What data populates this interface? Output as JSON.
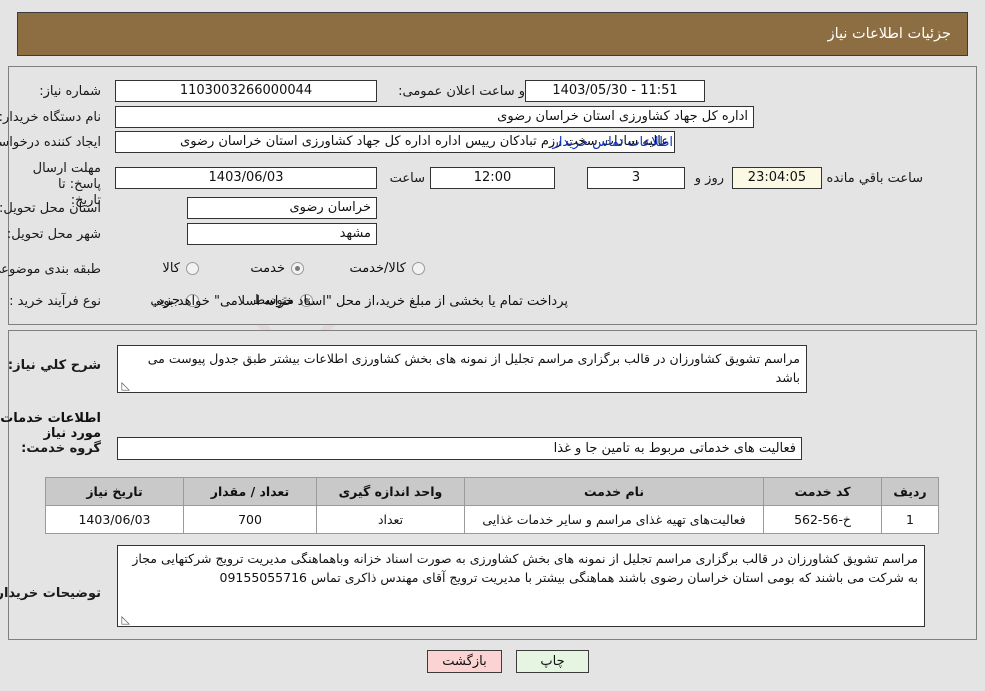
{
  "header": {
    "title": "جزئیات اطلاعات نیاز"
  },
  "watermark": {
    "text": "AriaTender.net",
    "shield_color": "#e8c0c4"
  },
  "form": {
    "need_number_label": "شماره نیاز:",
    "need_number_value": "1103003266000044",
    "public_announce_label": "تاریخ و ساعت اعلان عمومی:",
    "public_announce_value": "11:51 - 1403/05/30",
    "buyer_org_label": "نام دستگاه خریدار:",
    "buyer_org_value": "اداره کل جهاد کشاورزی استان خراسان رضوی",
    "requester_label": "ایجاد کننده درخواست:",
    "requester_value": "عالیه سادات سخت رزم تبادکان رییس اداره  اداره کل جهاد کشاورزی استان خراسان رضوی",
    "buyer_contact_link": "اطلاعات تماس خریدار",
    "deadline_label": "مهلت ارسال پاسخ: تا تاریخ:",
    "deadline_date": "1403/06/03",
    "hour_label": "ساعت",
    "deadline_time": "12:00",
    "days_remaining": "3",
    "days_label": "روز و",
    "countdown": "23:04:05",
    "remaining_label": "ساعت باقي مانده",
    "province_label": "استان محل تحویل:",
    "province_value": "خراسان رضوی",
    "city_label": "شهر محل تحویل:",
    "city_value": "مشهد",
    "category_label": "طبقه بندی موضوعی:",
    "category_options": [
      {
        "label": "کالا",
        "selected": false
      },
      {
        "label": "خدمت",
        "selected": true
      },
      {
        "label": "کالا/خدمت",
        "selected": false
      }
    ],
    "process_label": "نوع فرآیند خرید :",
    "process_options": [
      {
        "label": "جزیي",
        "selected": false
      },
      {
        "label": "متوسط",
        "selected": true
      }
    ],
    "treasury_note": "پرداخت تمام یا بخشی از مبلغ خرید،از محل \"اسناد خزانه اسلامی\" خواهد بود."
  },
  "description": {
    "label": "شرح کلي نیاز:",
    "value": "مراسم تشویق کشاورزان در قالب برگزاری مراسم تجلیل از نمونه های بخش کشاورزی اطلاعات بیشتر طبق جدول پیوست می باشد"
  },
  "services": {
    "section_title": "اطلاعات خدمات مورد نیاز",
    "group_label": "گروه خدمت:",
    "group_value": "فعالیت های خدماتی مربوط به تامین جا و غذا",
    "table": {
      "headers": [
        "ردیف",
        "کد خدمت",
        "نام خدمت",
        "واحد اندازه گیری",
        "تعداد / مقدار",
        "تاریخ نیاز"
      ],
      "rows": [
        {
          "row": "1",
          "code": "خ-56-562",
          "name": "فعالیت‌های تهیه غذای مراسم و سایر خدمات غذایی",
          "unit": "تعداد",
          "qty": "700",
          "date": "1403/06/03"
        }
      ]
    }
  },
  "buyer_notes": {
    "label": "توضیحات خریدار:",
    "value": "مراسم تشویق کشاورزان در قالب برگزاری مراسم تجلیل از نمونه های بخش کشاورزی به صورت اسناد خزانه وباهماهنگی مدیریت ترویج شرکتهایی مجاز به شرکت می باشند که بومی استان خراسان رضوی باشند هماهنگی بیشتر با مدیریت ترویج آقای مهندس ذاکری تماس 09155055716"
  },
  "buttons": {
    "back": "بازگشت",
    "print": "چاپ"
  }
}
